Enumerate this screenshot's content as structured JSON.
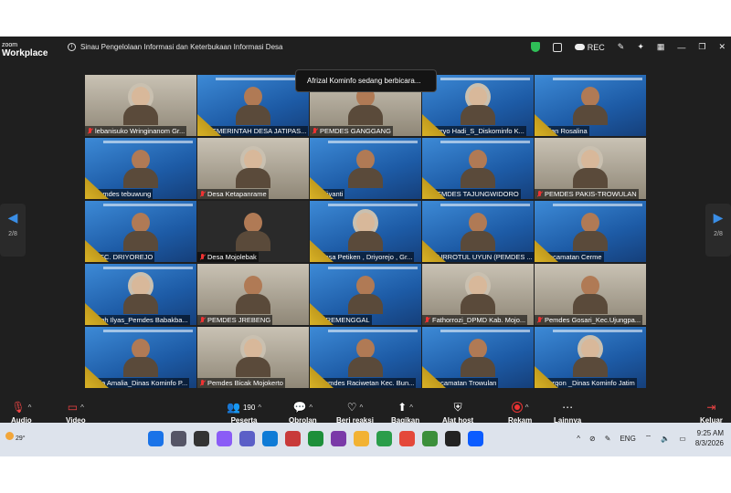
{
  "app": {
    "logo_line1": "zoom",
    "logo_line2": "Workplace"
  },
  "meeting": {
    "title": "Sinau Pengelolaan Informasi dan Keterbukaan Informasi Desa"
  },
  "top_controls": {
    "rec_label": "REC"
  },
  "toast": {
    "text": "Afrizal Kominfo sedang berbicara..."
  },
  "pagination": {
    "left_page": "2/8",
    "right_page": "2/8"
  },
  "tiles": [
    {
      "name": "lebanisuko Wringinanom Gr...",
      "kind": "room"
    },
    {
      "name": "PEMERINTAH DESA JATIPAS...",
      "kind": "slide"
    },
    {
      "name": "PEMDES GANGGANG",
      "kind": "room"
    },
    {
      "name": "Suryo Hadi_S_Diskominfo K...",
      "kind": "slide"
    },
    {
      "name": "Dian Rosalina",
      "kind": "slide"
    },
    {
      "name": "pemdes tebuwung",
      "kind": "slide"
    },
    {
      "name": "Desa Ketapanrame",
      "kind": "room"
    },
    {
      "name": "fujiyanti",
      "kind": "slide"
    },
    {
      "name": "PEMDES TAJUNGWIDORO",
      "kind": "slide"
    },
    {
      "name": "PEMDES PAKIS-TROWULAN",
      "kind": "room"
    },
    {
      "name": "KEC. DRIYOREJO",
      "kind": "slide"
    },
    {
      "name": "Desa Mojolebak",
      "kind": "dark"
    },
    {
      "name": "Desa Petiken , Driyorejo , Gr...",
      "kind": "slide"
    },
    {
      "name": "QURROTUL UYUN (PEMDES ...",
      "kind": "slide"
    },
    {
      "name": "Kecamatan Cerme",
      "kind": "slide"
    },
    {
      "name": "Moh Ilyas_Pemdes Babakba...",
      "kind": "slide"
    },
    {
      "name": "PEMDES JREBENG",
      "kind": "room"
    },
    {
      "name": "TIREMENGGAL",
      "kind": "slide"
    },
    {
      "name": "Fathorrozi_DPMD Kab. Mojo...",
      "kind": "room"
    },
    {
      "name": "Pemdes Gosari_Kec.Ujungpa...",
      "kind": "room"
    },
    {
      "name": "Ria Amalia_Dinas Kominfo P...",
      "kind": "slide"
    },
    {
      "name": "Pemdes Bicak Mojokerto",
      "kind": "room"
    },
    {
      "name": "Pemdes Raciwetan Kec. Bun...",
      "kind": "slide"
    },
    {
      "name": "Kecamatan Trowulan",
      "kind": "slide"
    },
    {
      "name": "Furqon _Dinas Kominfo Jatim",
      "kind": "slide"
    }
  ],
  "toolbar": {
    "audio": "Audio",
    "video": "Video",
    "participants": "Peserta",
    "participants_count": "190",
    "chat": "Obrolan",
    "reactions": "Beri reaksi",
    "share": "Bagikan",
    "host_tools": "Alat host",
    "record": "Rekam",
    "more": "Lainnya",
    "leave": "Keluar"
  },
  "taskbar": {
    "temperature": "29°",
    "language": "ENG",
    "time": "9:25 AM",
    "date": "8/3/2026"
  }
}
